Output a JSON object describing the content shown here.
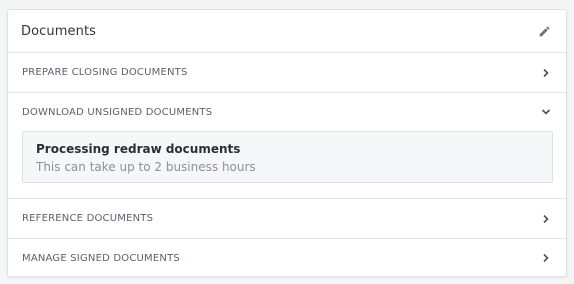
{
  "card": {
    "title": "Documents",
    "edit_icon": "pencil-icon"
  },
  "sections": [
    {
      "label": "PREPARE CLOSING DOCUMENTS",
      "state": "collapsed",
      "icon": "chevron-right-icon"
    },
    {
      "label": "DOWNLOAD UNSIGNED DOCUMENTS",
      "state": "expanded",
      "icon": "chevron-down-icon",
      "notice": {
        "title": "Processing redraw documents",
        "text": "This can take up to 2 business hours"
      }
    },
    {
      "label": "REFERENCE DOCUMENTS",
      "state": "collapsed",
      "icon": "chevron-right-icon"
    },
    {
      "label": "MANAGE SIGNED DOCUMENTS",
      "state": "collapsed",
      "icon": "chevron-right-icon"
    }
  ],
  "colors": {
    "text_primary": "#2f3640",
    "text_secondary": "#5a6270",
    "muted": "#8b929c",
    "border": "#e4e6ea"
  }
}
